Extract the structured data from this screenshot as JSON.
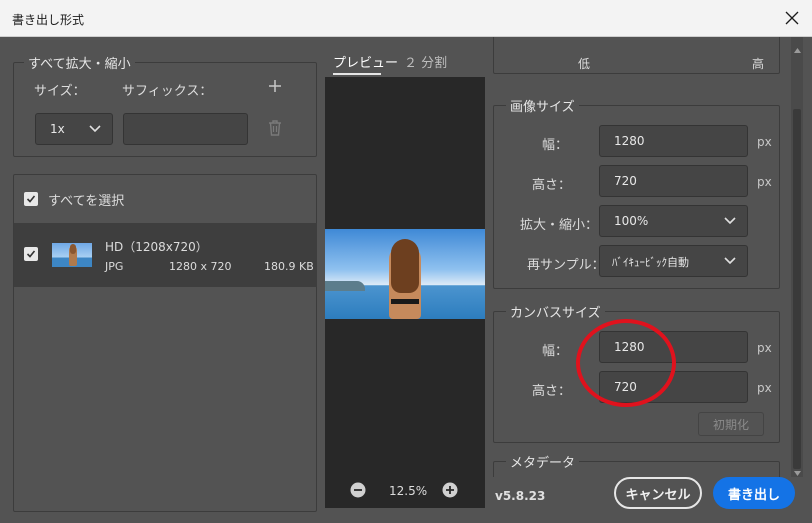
{
  "window": {
    "title": "書き出し形式"
  },
  "scale_panel": {
    "legend": "すべて拡大・縮小",
    "size_label": "サイズ：",
    "suffix_label": "サフィックス：",
    "scale_value": "1x",
    "suffix_value": ""
  },
  "assets": {
    "select_all": "すべてを選択",
    "item": {
      "name": "HD（1208x720）",
      "format": "JPG",
      "dimensions": "1280 x 720",
      "filesize": "180.9 KB"
    }
  },
  "tabs": {
    "preview": "プレビュー",
    "split": "２ 分割"
  },
  "zoom": {
    "value": "12.5%"
  },
  "quality": {
    "low": "低",
    "high": "高"
  },
  "image_size": {
    "legend": "画像サイズ",
    "width_label": "幅：",
    "width_value": "1280",
    "width_unit": "px",
    "height_label": "高さ：",
    "height_value": "720",
    "height_unit": "px",
    "scale_label": "拡大・縮小：",
    "scale_value": "100%",
    "resample_label": "再サンプル：",
    "resample_value": "ﾊﾞｲｷｭｰﾋﾞｯｸ自動"
  },
  "canvas_size": {
    "legend": "カンバスサイズ",
    "width_label": "幅：",
    "width_value": "1280",
    "width_unit": "px",
    "height_label": "高さ：",
    "height_value": "720",
    "height_unit": "px",
    "reset_label": "初期化"
  },
  "metadata": {
    "legend": "メタデータ"
  },
  "footer": {
    "version": "v5.8.23",
    "cancel": "キャンセル",
    "export": "書き出し"
  },
  "colors": {
    "accent": "#1473e6",
    "annotation": "#e0121d"
  }
}
